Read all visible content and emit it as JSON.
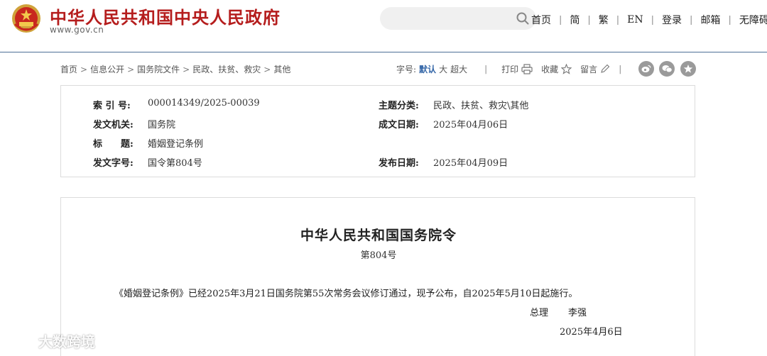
{
  "site": {
    "title": "中华人民共和国中央人民政府",
    "domain": "www.gov.cn",
    "emblem_icon": "national-emblem-icon",
    "brand_color": "#b51d1d"
  },
  "search": {
    "placeholder": "",
    "icon": "search-icon"
  },
  "topnav": {
    "home": "首页",
    "simplified": "简",
    "traditional": "繁",
    "english": "EN",
    "login": "登录",
    "mail": "邮箱",
    "accessibility": "无障碍"
  },
  "breadcrumb": [
    "首页",
    "信息公开",
    "国务院文件",
    "民政、扶贫、救灾",
    "其他"
  ],
  "tools": {
    "font_label": "字号:",
    "font_default": "默认",
    "font_large": "大",
    "font_xlarge": "超大",
    "print": "打印",
    "favorite": "收藏",
    "comment": "留言",
    "accent_color": "#3567a8"
  },
  "share": [
    "weibo-icon",
    "wechat-icon",
    "qzone-star-icon"
  ],
  "meta": {
    "index_label": "索 引 号:",
    "index_value": "000014349/2025-00039",
    "topic_label": "主题分类:",
    "topic_value": "民政、扶贫、救灾\\其他",
    "issuer_label": "发文机关:",
    "issuer_value": "国务院",
    "created_label": "成文日期:",
    "created_value": "2025年04月06日",
    "title_label": "标　　题:",
    "title_value": "婚姻登记条例",
    "docno_label": "发文字号:",
    "docno_value": "国令第804号",
    "published_label": "发布日期:",
    "published_value": "2025年04月09日"
  },
  "document": {
    "title": "中华人民共和国国务院令",
    "number": "第804号",
    "body": "《婚姻登记条例》已经2025年3月21日国务院第55次常务会议修订通过，现予公布，自2025年5月10日起施行。",
    "sign_title": "总理",
    "sign_name": "李强",
    "sign_date": "2025年4月6日"
  },
  "watermark": "大数跨境"
}
